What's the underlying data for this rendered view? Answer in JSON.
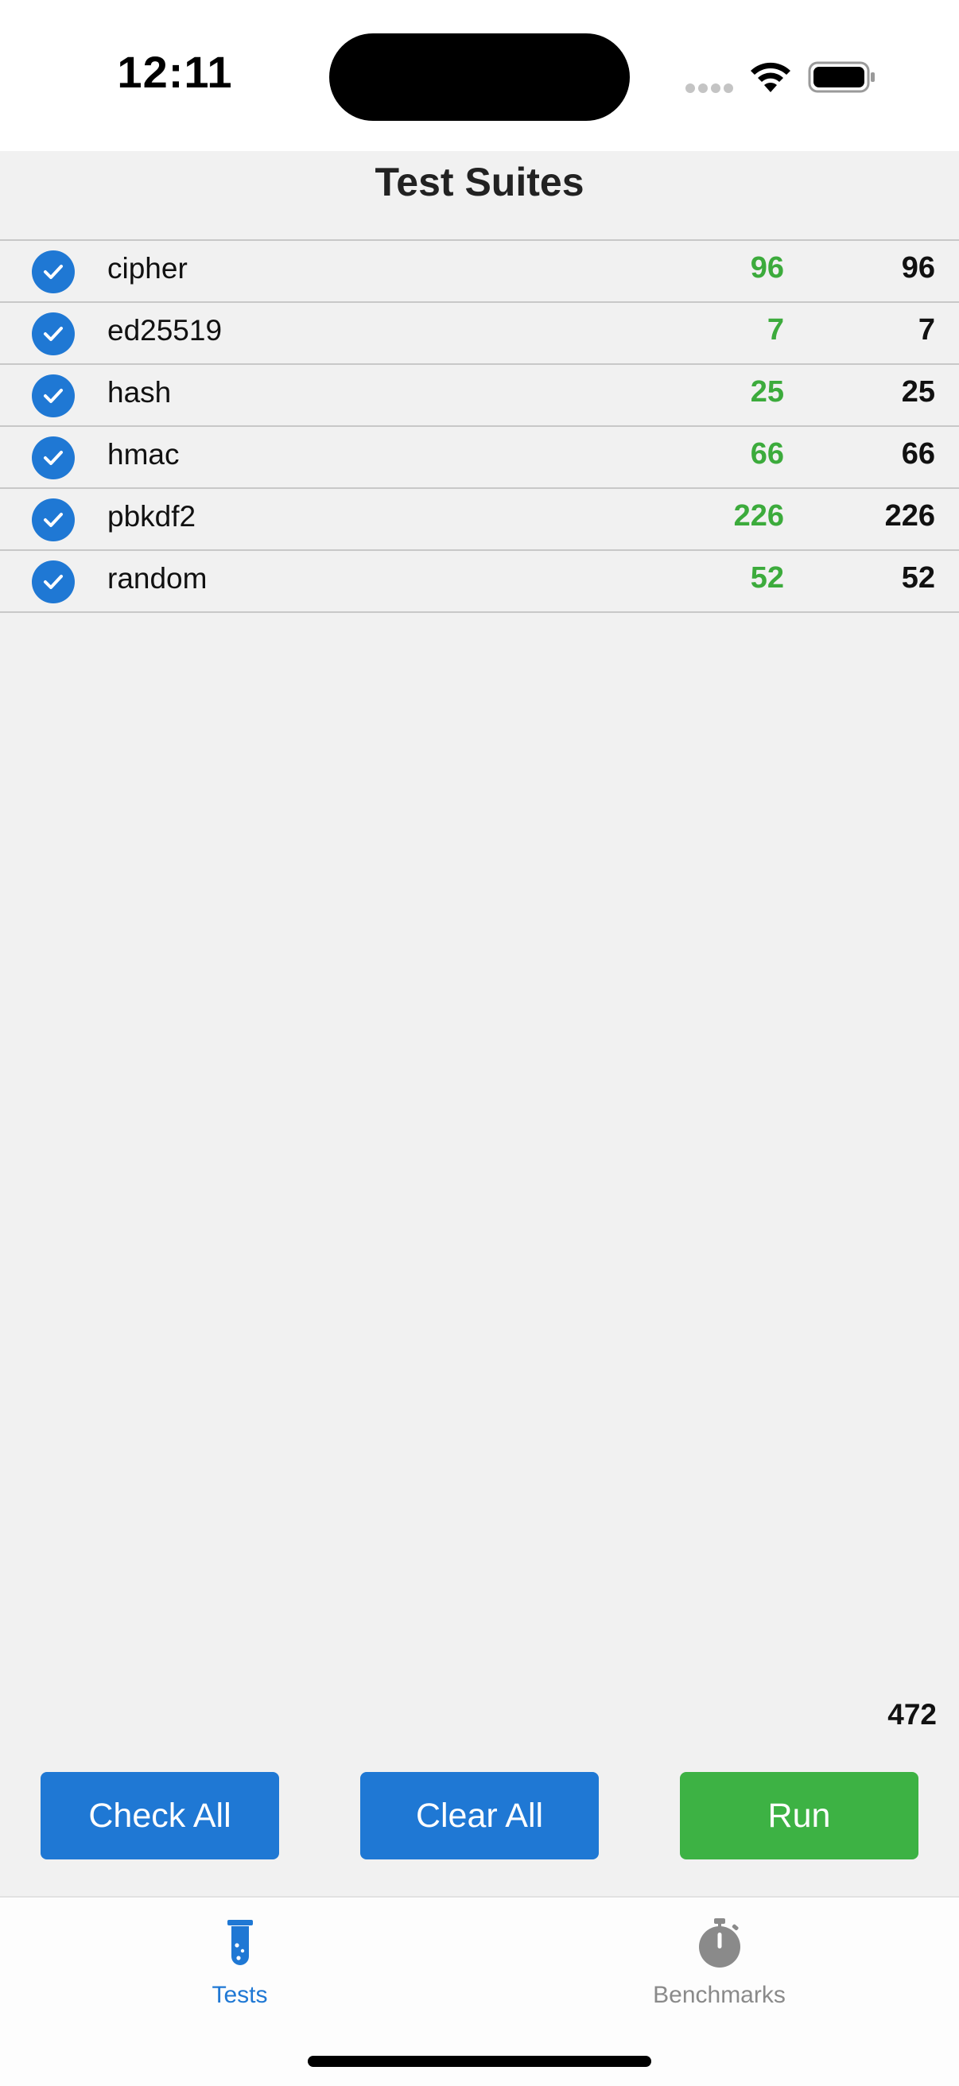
{
  "status_bar": {
    "time": "12:11"
  },
  "header": {
    "title": "Test Suites"
  },
  "suites": [
    {
      "name": "cipher",
      "passed": "96",
      "total": "96",
      "checked": true
    },
    {
      "name": "ed25519",
      "passed": "7",
      "total": "7",
      "checked": true
    },
    {
      "name": "hash",
      "passed": "25",
      "total": "25",
      "checked": true
    },
    {
      "name": "hmac",
      "passed": "66",
      "total": "66",
      "checked": true
    },
    {
      "name": "pbkdf2",
      "passed": "226",
      "total": "226",
      "checked": true
    },
    {
      "name": "random",
      "passed": "52",
      "total": "52",
      "checked": true
    }
  ],
  "footer": {
    "grand_total": "472"
  },
  "actions": {
    "check_all": "Check All",
    "clear_all": "Clear All",
    "run": "Run"
  },
  "tabs": [
    {
      "label": "Tests",
      "icon": "test-tube-icon",
      "active": true
    },
    {
      "label": "Benchmarks",
      "icon": "stopwatch-icon",
      "active": false
    }
  ],
  "colors": {
    "accent_blue": "#1f78d4",
    "pass_green": "#3cab3c",
    "run_green": "#3db244",
    "inactive_gray": "#8a8a8a"
  }
}
